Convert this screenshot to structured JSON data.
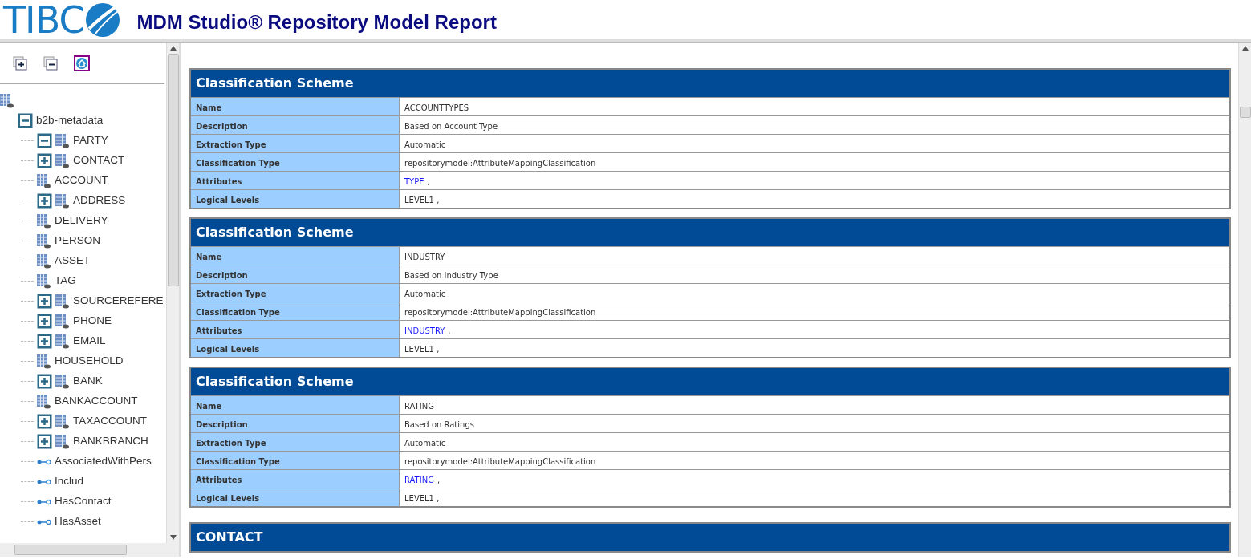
{
  "header": {
    "logo": "TIBC",
    "title": "MDM Studio® Repository Model Report"
  },
  "tree": {
    "root": {
      "label": "b2b-metadata",
      "expanded": true,
      "children": [
        {
          "label": "PARTY",
          "kind": "entity",
          "expanded": true
        },
        {
          "label": "CONTACT",
          "kind": "entity",
          "expanded": false
        },
        {
          "label": "ACCOUNT",
          "kind": "leaf"
        },
        {
          "label": "ADDRESS",
          "kind": "entity",
          "expanded": false
        },
        {
          "label": "DELIVERY",
          "kind": "leaf"
        },
        {
          "label": "PERSON",
          "kind": "leaf"
        },
        {
          "label": "ASSET",
          "kind": "leaf"
        },
        {
          "label": "TAG",
          "kind": "leaf"
        },
        {
          "label": "SOURCEREFERE",
          "kind": "entity",
          "expanded": false
        },
        {
          "label": "PHONE",
          "kind": "entity",
          "expanded": false
        },
        {
          "label": "EMAIL",
          "kind": "entity",
          "expanded": false
        },
        {
          "label": "HOUSEHOLD",
          "kind": "leaf"
        },
        {
          "label": "BANK",
          "kind": "entity",
          "expanded": false
        },
        {
          "label": "BANKACCOUNT",
          "kind": "leaf"
        },
        {
          "label": "TAXACCOUNT",
          "kind": "entity",
          "expanded": false
        },
        {
          "label": "BANKBRANCH",
          "kind": "entity",
          "expanded": false
        },
        {
          "label": "AssociatedWithPers",
          "kind": "relation"
        },
        {
          "label": "Includ",
          "kind": "relation"
        },
        {
          "label": "HasContact",
          "kind": "relation"
        },
        {
          "label": "HasAsset",
          "kind": "relation"
        }
      ]
    }
  },
  "sections": [
    {
      "title": "Classification Scheme",
      "rows": [
        {
          "label": "Name",
          "value": "ACCOUNTTYPES",
          "kind": "text"
        },
        {
          "label": "Description",
          "value": "Based on Account Type",
          "kind": "text"
        },
        {
          "label": "Extraction Type",
          "value": "Automatic",
          "kind": "text"
        },
        {
          "label": "Classification Type",
          "value": "repositorymodel:AttributeMappingClassification",
          "kind": "text"
        },
        {
          "label": "Attributes",
          "value": "TYPE",
          "suffix": ",",
          "kind": "link"
        },
        {
          "label": "Logical Levels",
          "value": "LEVEL1 ,",
          "kind": "text"
        }
      ]
    },
    {
      "title": "Classification Scheme",
      "rows": [
        {
          "label": "Name",
          "value": "INDUSTRY",
          "kind": "text"
        },
        {
          "label": "Description",
          "value": "Based on Industry Type",
          "kind": "text"
        },
        {
          "label": "Extraction Type",
          "value": "Automatic",
          "kind": "text"
        },
        {
          "label": "Classification Type",
          "value": "repositorymodel:AttributeMappingClassification",
          "kind": "text"
        },
        {
          "label": "Attributes",
          "value": "INDUSTRY",
          "suffix": ",",
          "kind": "link"
        },
        {
          "label": "Logical Levels",
          "value": "LEVEL1 ,",
          "kind": "text"
        }
      ]
    },
    {
      "title": "Classification Scheme",
      "rows": [
        {
          "label": "Name",
          "value": "RATING",
          "kind": "text"
        },
        {
          "label": "Description",
          "value": "Based on Ratings",
          "kind": "text"
        },
        {
          "label": "Extraction Type",
          "value": "Automatic",
          "kind": "text"
        },
        {
          "label": "Classification Type",
          "value": "repositorymodel:AttributeMappingClassification",
          "kind": "text"
        },
        {
          "label": "Attributes",
          "value": "RATING",
          "suffix": ",",
          "kind": "link"
        },
        {
          "label": "Logical Levels",
          "value": "LEVEL1 ,",
          "kind": "text"
        }
      ]
    },
    {
      "title": "CONTACT"
    }
  ]
}
